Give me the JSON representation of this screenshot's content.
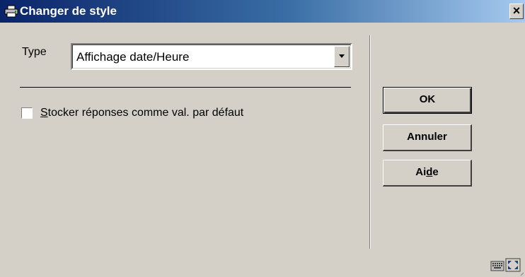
{
  "window": {
    "title": "Changer de style",
    "close_label": "×"
  },
  "form": {
    "type_label": "Type",
    "type_value": "Affichage date/Heure",
    "checkbox_label": "Stocker réponses comme val. par défaut",
    "checkbox_checked": false
  },
  "buttons": {
    "ok": "OK",
    "cancel": "Annuler",
    "help": "Aide"
  },
  "icons": {
    "title": "printer-icon",
    "status1": "keyboard-icon",
    "status2": "maximize-icon"
  },
  "colors": {
    "titlebar_start": "#0a246a",
    "titlebar_end": "#a6caf0",
    "window_bg": "#d4d0c8"
  }
}
